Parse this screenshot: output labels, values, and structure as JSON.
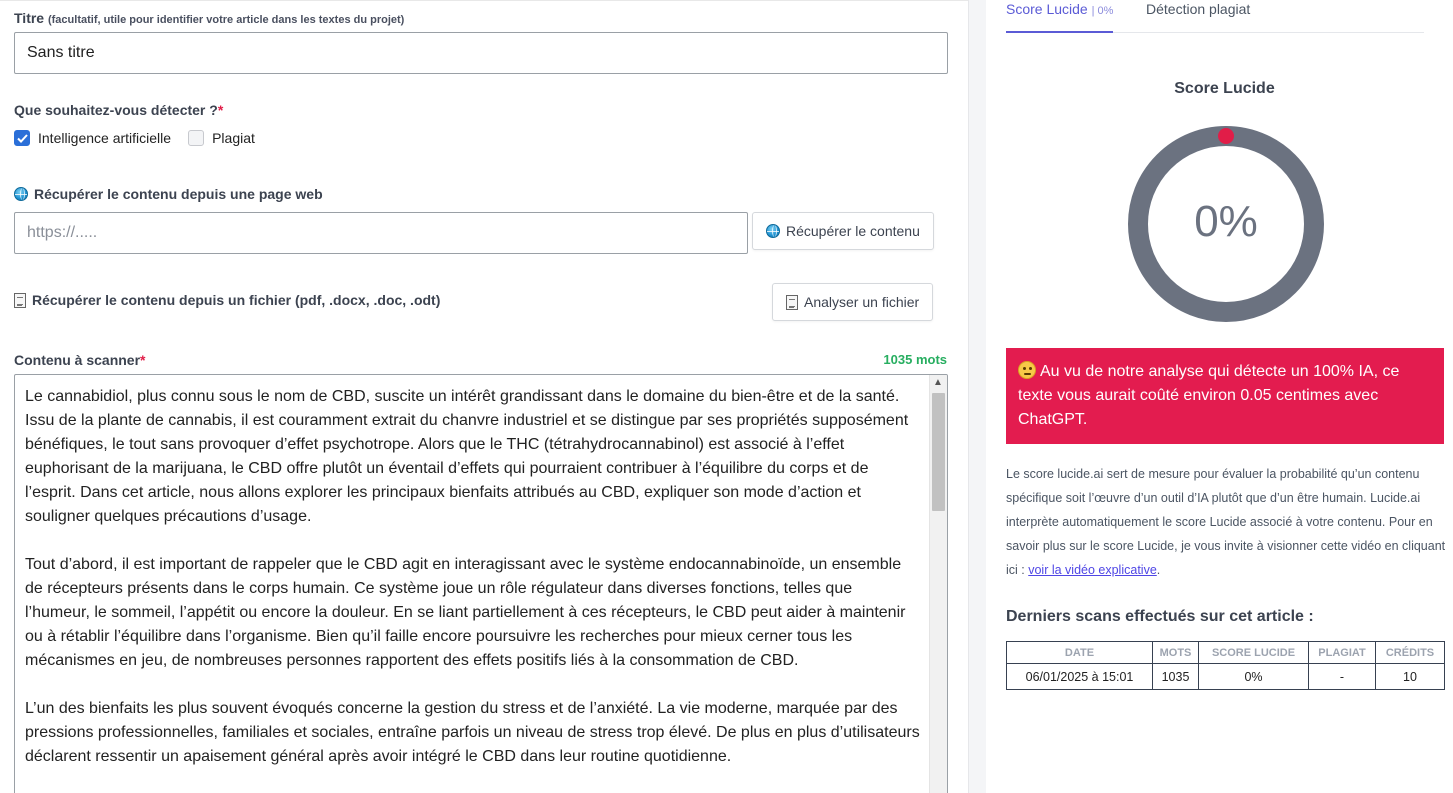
{
  "form": {
    "title_label": "Titre",
    "title_hint": "(facultatif, utile pour identifier votre article dans les textes du projet)",
    "title_value": "Sans titre",
    "detect_label": "Que souhaitez-vous détecter ?",
    "required_mark": "*",
    "options": [
      {
        "label": "Intelligence artificielle",
        "checked": true
      },
      {
        "label": "Plagiat",
        "checked": false
      }
    ],
    "url_section_label": "Récupérer le contenu depuis une page web",
    "url_placeholder": "https://.....",
    "url_button": "Récupérer le contenu",
    "file_section_label": "Récupérer le contenu depuis un fichier (pdf, .docx, .doc, .odt)",
    "file_button": "Analyser un fichier",
    "content_label": "Contenu à scanner",
    "word_count": "1035 mots",
    "paragraphs": [
      "Le cannabidiol, plus connu sous le nom de CBD, suscite un intérêt grandissant dans le domaine du bien-être et de la santé. Issu de la plante de cannabis, il est couramment extrait du chanvre industriel et se distingue par ses propriétés supposément bénéfiques, le tout sans provoquer d’effet psychotrope. Alors que le THC (tétrahydrocannabinol) est associé à l’effet euphorisant de la marijuana, le CBD offre plutôt un éventail d’effets qui pourraient contribuer à l’équilibre du corps et de l’esprit. Dans cet article, nous allons explorer les principaux bienfaits attribués au CBD, expliquer son mode d’action et souligner quelques précautions d’usage.",
      "Tout d’abord, il est important de rappeler que le CBD agit en interagissant avec le système endocannabinoïde, un ensemble de récepteurs présents dans le corps humain. Ce système joue un rôle régulateur dans diverses fonctions, telles que l’humeur, le sommeil, l’appétit ou encore la douleur. En se liant partiellement à ces récepteurs, le CBD peut aider à maintenir ou à rétablir l’équilibre dans l’organisme. Bien qu’il faille encore poursuivre les recherches pour mieux cerner tous les mécanismes en jeu, de nombreuses personnes rapportent des effets positifs liés à la consommation de CBD.",
      "L’un des bienfaits les plus souvent évoqués concerne la gestion du stress et de l’anxiété. La vie moderne, marquée par des pressions professionnelles, familiales et sociales, entraîne parfois un niveau de stress trop élevé. De plus en plus d’utilisateurs déclarent ressentir un apaisement général après avoir intégré le CBD dans leur routine quotidienne."
    ]
  },
  "sidebar": {
    "tabs": [
      {
        "label": "Score Lucide",
        "badge": "0%"
      },
      {
        "label": "Détection plagiat"
      }
    ],
    "gauge_title": "Score Lucide",
    "gauge_value": 0,
    "gauge_text": "0%",
    "colors": {
      "ring": "#6b7280",
      "marker": "#e11d48",
      "alert": "#e31c4f",
      "accent": "#5b5bd6"
    },
    "alert_text": "Au vu de notre analyse qui détecte un 100% IA, ce texte vous aurait coûté environ 0.05 centimes avec ChatGPT.",
    "info_text": "Le score lucide.ai sert de mesure pour évaluer la probabilité qu’un contenu spécifique soit l’œuvre d’un outil d’IA plutôt que d’un être humain. Lucide.ai interprète automatiquement le score Lucide associé à votre contenu. Pour en savoir plus sur le score Lucide, je vous invite à visionner cette vidéo en cliquant ici : ",
    "info_link": "voir la vidéo explicative",
    "info_end": ".",
    "scans_title": "Derniers scans effectués sur cet article :",
    "table": {
      "headers": [
        "DATE",
        "MOTS",
        "SCORE LUCIDE",
        "PLAGIAT",
        "CRÉDITS"
      ],
      "rows": [
        [
          "06/01/2025 à 15:01",
          "1035",
          "0%",
          "-",
          "10"
        ]
      ]
    }
  }
}
